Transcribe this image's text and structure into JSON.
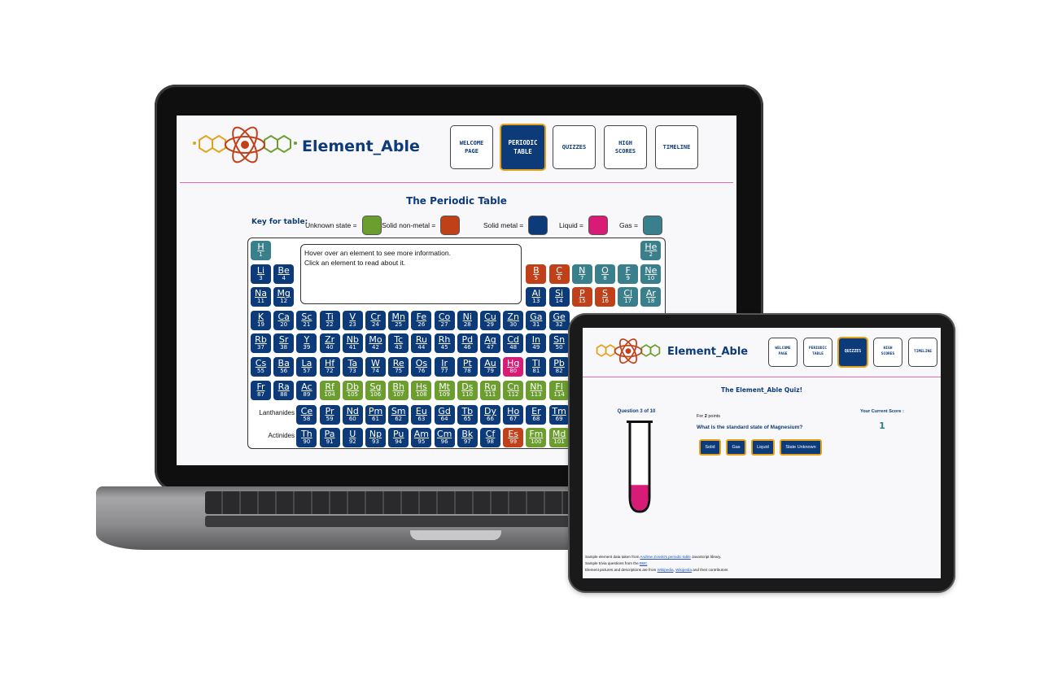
{
  "colors": {
    "brand_blue": "#0d3b7a",
    "unknown": "#6b9e2e",
    "nonmetal": "#c0401a",
    "metal": "#0d3b7a",
    "liquid": "#d81b76",
    "gas": "#3a7f8c",
    "accent_border": "#e3a21a",
    "divider": "#e26aa8"
  },
  "app": {
    "brand": "Element_Able",
    "logo_icon": "atom-molecule-logo"
  },
  "nav": [
    {
      "label": "WELCOME PAGE"
    },
    {
      "label": "PERIODIC TABLE"
    },
    {
      "label": "QUIZZES"
    },
    {
      "label": "HIGH SCORES"
    },
    {
      "label": "TIMELINE"
    }
  ],
  "laptop": {
    "active_tab": "PERIODIC TABLE",
    "title": "The Periodic Table",
    "key_label": "Key for table:",
    "key": [
      {
        "label": "Unknown state =",
        "state": "unknown"
      },
      {
        "label": "Solid non-metal =",
        "state": "nonmetal"
      },
      {
        "label": "Solid metal =",
        "state": "metal"
      },
      {
        "label": "Liquid =",
        "state": "liquid"
      },
      {
        "label": "Gas =",
        "state": "gas"
      }
    ],
    "info_line1": "Hover over an element to see more information.",
    "info_line2": "Click an element to read about it.",
    "lanthanides_label": "Lanthanides",
    "actinides_label": "Actinides",
    "elements": [
      {
        "s": "H",
        "n": "1",
        "c": "gas",
        "col": 1,
        "row": 1
      },
      {
        "s": "He",
        "n": "2",
        "c": "gas",
        "col": 18,
        "row": 1
      },
      {
        "s": "Li",
        "n": "3",
        "c": "metal",
        "col": 1,
        "row": 2
      },
      {
        "s": "Be",
        "n": "4",
        "c": "metal",
        "col": 2,
        "row": 2
      },
      {
        "s": "B",
        "n": "5",
        "c": "nonmetal",
        "col": 13,
        "row": 2
      },
      {
        "s": "C",
        "n": "6",
        "c": "nonmetal",
        "col": 14,
        "row": 2
      },
      {
        "s": "N",
        "n": "7",
        "c": "gas",
        "col": 15,
        "row": 2
      },
      {
        "s": "O",
        "n": "8",
        "c": "gas",
        "col": 16,
        "row": 2
      },
      {
        "s": "F",
        "n": "9",
        "c": "gas",
        "col": 17,
        "row": 2
      },
      {
        "s": "Ne",
        "n": "10",
        "c": "gas",
        "col": 18,
        "row": 2
      },
      {
        "s": "Na",
        "n": "11",
        "c": "metal",
        "col": 1,
        "row": 3
      },
      {
        "s": "Mg",
        "n": "12",
        "c": "metal",
        "col": 2,
        "row": 3
      },
      {
        "s": "Al",
        "n": "13",
        "c": "metal",
        "col": 13,
        "row": 3
      },
      {
        "s": "Si",
        "n": "14",
        "c": "metal",
        "col": 14,
        "row": 3
      },
      {
        "s": "P",
        "n": "15",
        "c": "nonmetal",
        "col": 15,
        "row": 3
      },
      {
        "s": "S",
        "n": "16",
        "c": "nonmetal",
        "col": 16,
        "row": 3
      },
      {
        "s": "Cl",
        "n": "17",
        "c": "gas",
        "col": 17,
        "row": 3
      },
      {
        "s": "Ar",
        "n": "18",
        "c": "gas",
        "col": 18,
        "row": 3
      },
      {
        "s": "K",
        "n": "19",
        "c": "metal",
        "col": 1,
        "row": 4
      },
      {
        "s": "Ca",
        "n": "20",
        "c": "metal",
        "col": 2,
        "row": 4
      },
      {
        "s": "Sc",
        "n": "21",
        "c": "metal",
        "col": 3,
        "row": 4
      },
      {
        "s": "Ti",
        "n": "22",
        "c": "metal",
        "col": 4,
        "row": 4
      },
      {
        "s": "V",
        "n": "23",
        "c": "metal",
        "col": 5,
        "row": 4
      },
      {
        "s": "Cr",
        "n": "24",
        "c": "metal",
        "col": 6,
        "row": 4
      },
      {
        "s": "Mn",
        "n": "25",
        "c": "metal",
        "col": 7,
        "row": 4
      },
      {
        "s": "Fe",
        "n": "26",
        "c": "metal",
        "col": 8,
        "row": 4
      },
      {
        "s": "Co",
        "n": "27",
        "c": "metal",
        "col": 9,
        "row": 4
      },
      {
        "s": "Ni",
        "n": "28",
        "c": "metal",
        "col": 10,
        "row": 4
      },
      {
        "s": "Cu",
        "n": "29",
        "c": "metal",
        "col": 11,
        "row": 4
      },
      {
        "s": "Zn",
        "n": "30",
        "c": "metal",
        "col": 12,
        "row": 4
      },
      {
        "s": "Ga",
        "n": "31",
        "c": "metal",
        "col": 13,
        "row": 4
      },
      {
        "s": "Ge",
        "n": "32",
        "c": "metal",
        "col": 14,
        "row": 4
      },
      {
        "s": "Rb",
        "n": "37",
        "c": "metal",
        "col": 1,
        "row": 5
      },
      {
        "s": "Sr",
        "n": "38",
        "c": "metal",
        "col": 2,
        "row": 5
      },
      {
        "s": "Y",
        "n": "39",
        "c": "metal",
        "col": 3,
        "row": 5
      },
      {
        "s": "Zr",
        "n": "40",
        "c": "metal",
        "col": 4,
        "row": 5
      },
      {
        "s": "Nb",
        "n": "41",
        "c": "metal",
        "col": 5,
        "row": 5
      },
      {
        "s": "Mo",
        "n": "42",
        "c": "metal",
        "col": 6,
        "row": 5
      },
      {
        "s": "Tc",
        "n": "43",
        "c": "metal",
        "col": 7,
        "row": 5
      },
      {
        "s": "Ru",
        "n": "44",
        "c": "metal",
        "col": 8,
        "row": 5
      },
      {
        "s": "Rh",
        "n": "45",
        "c": "metal",
        "col": 9,
        "row": 5
      },
      {
        "s": "Pd",
        "n": "46",
        "c": "metal",
        "col": 10,
        "row": 5
      },
      {
        "s": "Ag",
        "n": "47",
        "c": "metal",
        "col": 11,
        "row": 5
      },
      {
        "s": "Cd",
        "n": "48",
        "c": "metal",
        "col": 12,
        "row": 5
      },
      {
        "s": "In",
        "n": "49",
        "c": "metal",
        "col": 13,
        "row": 5
      },
      {
        "s": "Sn",
        "n": "50",
        "c": "metal",
        "col": 14,
        "row": 5
      },
      {
        "s": "Cs",
        "n": "55",
        "c": "metal",
        "col": 1,
        "row": 6
      },
      {
        "s": "Ba",
        "n": "56",
        "c": "metal",
        "col": 2,
        "row": 6
      },
      {
        "s": "La",
        "n": "57",
        "c": "metal",
        "col": 3,
        "row": 6
      },
      {
        "s": "Hf",
        "n": "72",
        "c": "metal",
        "col": 4,
        "row": 6
      },
      {
        "s": "Ta",
        "n": "73",
        "c": "metal",
        "col": 5,
        "row": 6
      },
      {
        "s": "W",
        "n": "74",
        "c": "metal",
        "col": 6,
        "row": 6
      },
      {
        "s": "Re",
        "n": "75",
        "c": "metal",
        "col": 7,
        "row": 6
      },
      {
        "s": "Os",
        "n": "76",
        "c": "metal",
        "col": 8,
        "row": 6
      },
      {
        "s": "Ir",
        "n": "77",
        "c": "metal",
        "col": 9,
        "row": 6
      },
      {
        "s": "Pt",
        "n": "78",
        "c": "metal",
        "col": 10,
        "row": 6
      },
      {
        "s": "Au",
        "n": "79",
        "c": "metal",
        "col": 11,
        "row": 6
      },
      {
        "s": "Hg",
        "n": "80",
        "c": "liquid",
        "col": 12,
        "row": 6
      },
      {
        "s": "Tl",
        "n": "81",
        "c": "metal",
        "col": 13,
        "row": 6
      },
      {
        "s": "Pb",
        "n": "82",
        "c": "metal",
        "col": 14,
        "row": 6
      },
      {
        "s": "Fr",
        "n": "87",
        "c": "metal",
        "col": 1,
        "row": 7
      },
      {
        "s": "Ra",
        "n": "88",
        "c": "metal",
        "col": 2,
        "row": 7
      },
      {
        "s": "Ac",
        "n": "89",
        "c": "metal",
        "col": 3,
        "row": 7
      },
      {
        "s": "Rf",
        "n": "104",
        "c": "unknown",
        "col": 4,
        "row": 7
      },
      {
        "s": "Db",
        "n": "105",
        "c": "unknown",
        "col": 5,
        "row": 7
      },
      {
        "s": "Sg",
        "n": "106",
        "c": "unknown",
        "col": 6,
        "row": 7
      },
      {
        "s": "Bh",
        "n": "107",
        "c": "unknown",
        "col": 7,
        "row": 7
      },
      {
        "s": "Hs",
        "n": "108",
        "c": "unknown",
        "col": 8,
        "row": 7
      },
      {
        "s": "Mt",
        "n": "109",
        "c": "unknown",
        "col": 9,
        "row": 7
      },
      {
        "s": "Ds",
        "n": "110",
        "c": "unknown",
        "col": 10,
        "row": 7
      },
      {
        "s": "Rg",
        "n": "111",
        "c": "unknown",
        "col": 11,
        "row": 7
      },
      {
        "s": "Cn",
        "n": "112",
        "c": "unknown",
        "col": 12,
        "row": 7
      },
      {
        "s": "Nh",
        "n": "113",
        "c": "unknown",
        "col": 13,
        "row": 7
      },
      {
        "s": "Fl",
        "n": "114",
        "c": "unknown",
        "col": 14,
        "row": 7
      },
      {
        "s": "Ce",
        "n": "58",
        "c": "metal",
        "col": 3,
        "row": 8
      },
      {
        "s": "Pr",
        "n": "59",
        "c": "metal",
        "col": 4,
        "row": 8
      },
      {
        "s": "Nd",
        "n": "60",
        "c": "metal",
        "col": 5,
        "row": 8
      },
      {
        "s": "Pm",
        "n": "61",
        "c": "metal",
        "col": 6,
        "row": 8
      },
      {
        "s": "Sm",
        "n": "62",
        "c": "metal",
        "col": 7,
        "row": 8
      },
      {
        "s": "Eu",
        "n": "63",
        "c": "metal",
        "col": 8,
        "row": 8
      },
      {
        "s": "Gd",
        "n": "64",
        "c": "metal",
        "col": 9,
        "row": 8
      },
      {
        "s": "Tb",
        "n": "65",
        "c": "metal",
        "col": 10,
        "row": 8
      },
      {
        "s": "Dy",
        "n": "66",
        "c": "metal",
        "col": 11,
        "row": 8
      },
      {
        "s": "Ho",
        "n": "67",
        "c": "metal",
        "col": 12,
        "row": 8
      },
      {
        "s": "Er",
        "n": "68",
        "c": "metal",
        "col": 13,
        "row": 8
      },
      {
        "s": "Tm",
        "n": "69",
        "c": "metal",
        "col": 14,
        "row": 8
      },
      {
        "s": "Th",
        "n": "90",
        "c": "metal",
        "col": 3,
        "row": 9
      },
      {
        "s": "Pa",
        "n": "91",
        "c": "metal",
        "col": 4,
        "row": 9
      },
      {
        "s": "U",
        "n": "92",
        "c": "metal",
        "col": 5,
        "row": 9
      },
      {
        "s": "Np",
        "n": "93",
        "c": "metal",
        "col": 6,
        "row": 9
      },
      {
        "s": "Pu",
        "n": "94",
        "c": "metal",
        "col": 7,
        "row": 9
      },
      {
        "s": "Am",
        "n": "95",
        "c": "metal",
        "col": 8,
        "row": 9
      },
      {
        "s": "Cm",
        "n": "96",
        "c": "metal",
        "col": 9,
        "row": 9
      },
      {
        "s": "Bk",
        "n": "97",
        "c": "metal",
        "col": 10,
        "row": 9
      },
      {
        "s": "Cf",
        "n": "98",
        "c": "metal",
        "col": 11,
        "row": 9
      },
      {
        "s": "Es",
        "n": "99",
        "c": "nonmetal",
        "col": 12,
        "row": 9
      },
      {
        "s": "Fm",
        "n": "100",
        "c": "unknown",
        "col": 13,
        "row": 9
      },
      {
        "s": "Md",
        "n": "101",
        "c": "unknown",
        "col": 14,
        "row": 9
      }
    ]
  },
  "tablet": {
    "active_tab": "QUIZZES",
    "quiz_title": "The Element_Able Quiz!",
    "question_counter": "Question 3 of 10",
    "score_label": "Your Current Score :",
    "score_value": "1",
    "points_prefix": "For",
    "points_value": "2",
    "points_suffix": "points",
    "question": "What is the standard state of Magnesium?",
    "answers": [
      "Solid",
      "Gas",
      "Liquid",
      "State Unknown"
    ],
    "progress_fraction": 0.3,
    "footer": [
      {
        "pre": "Sample element data taken from ",
        "link": "Andrew Zonski's periodic-table",
        "post": " JavaScript library."
      },
      {
        "pre": "Sample trivia questions from the ",
        "link": "BBC",
        "post": ""
      },
      {
        "pre": "Element pictures and descriptions are from ",
        "link": "Wikipedia",
        "mid": ", ",
        "link2": "Wikipedia",
        "post": " and their contributors"
      }
    ]
  }
}
